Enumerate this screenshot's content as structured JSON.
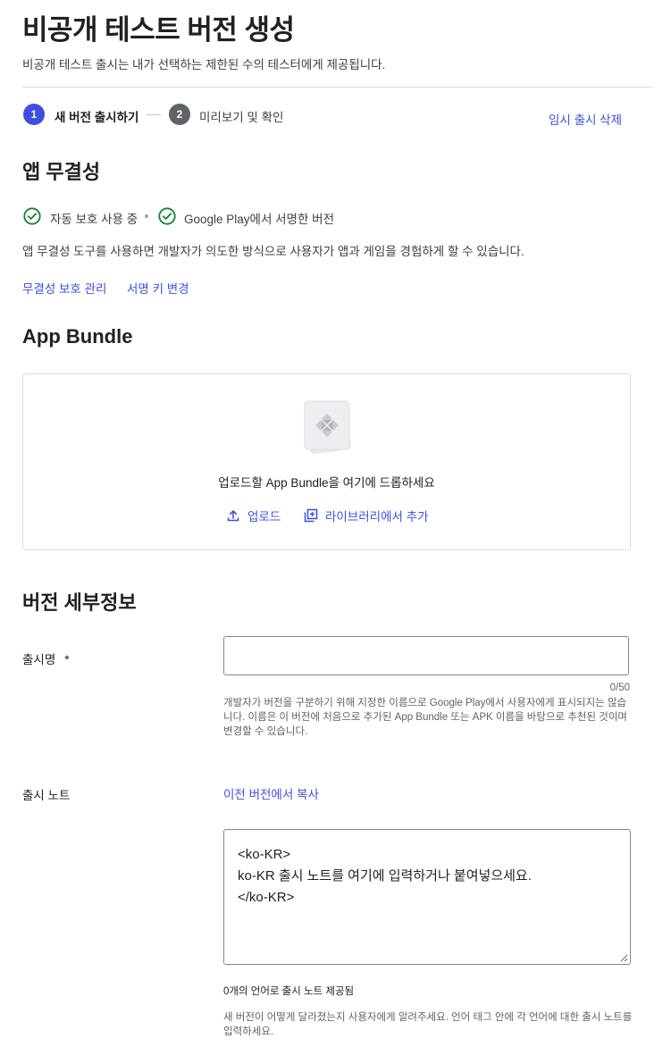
{
  "page": {
    "title": "비공개 테스트 버전 생성",
    "subtitle": "비공개 테스트 출시는 내가 선택하는 제한된 수의 테스터에게 제공됩니다."
  },
  "stepper": {
    "steps": [
      {
        "number": "1",
        "label": "새 버전 출시하기",
        "active": true
      },
      {
        "number": "2",
        "label": "미리보기 및 확인",
        "active": false
      }
    ],
    "discard_label": "임시 출시 삭제"
  },
  "integrity": {
    "heading": "앱 무결성",
    "statuses": [
      "자동 보호 사용 중",
      "Google Play에서 서명한 버전"
    ],
    "description": "앱 무결성 도구를 사용하면 개발자가 의도한 방식으로 사용자가 앱과 게임을 경험하게 할 수 있습니다.",
    "manage_link": "무결성 보호 관리",
    "change_key_link": "서명 키 변경"
  },
  "bundle": {
    "heading": "App Bundle",
    "drop_text": "업로드할 App Bundle을 여기에 드롭하세요",
    "upload_label": "업로드",
    "library_label": "라이브러리에서 추가"
  },
  "details": {
    "heading": "버전 세부정보",
    "release_name": {
      "label": "출시명",
      "required_mark": "*",
      "value": "",
      "counter": "0/50",
      "help": "개발자가 버전을 구분하기 위해 지정한 이름으로 Google Play에서 사용자에게 표시되지는 않습니다. 이름은 이 버전에 처음으로 추가된 App Bundle 또는 APK 이름을 바탕으로 추천된 것이며 변경할 수 있습니다."
    },
    "release_notes": {
      "label": "출시 노트",
      "copy_link": "이전 버전에서 복사",
      "value": "<ko-KR>\nko-KR 출시 노트를 여기에 입력하거나 붙여넣으세요.\n</ko-KR>",
      "language_count": "0개의 언어로 출시 노트 제공됨",
      "help": "새 버전이 어떻게 달라졌는지 사용자에게 알려주세요. 언어 태그 안에 각 언어에 대한 출시 노트를 입력하세요."
    }
  },
  "colors": {
    "accent": "#3c4fe0",
    "success": "#188038",
    "text": "#202124",
    "muted": "#5f6368"
  }
}
